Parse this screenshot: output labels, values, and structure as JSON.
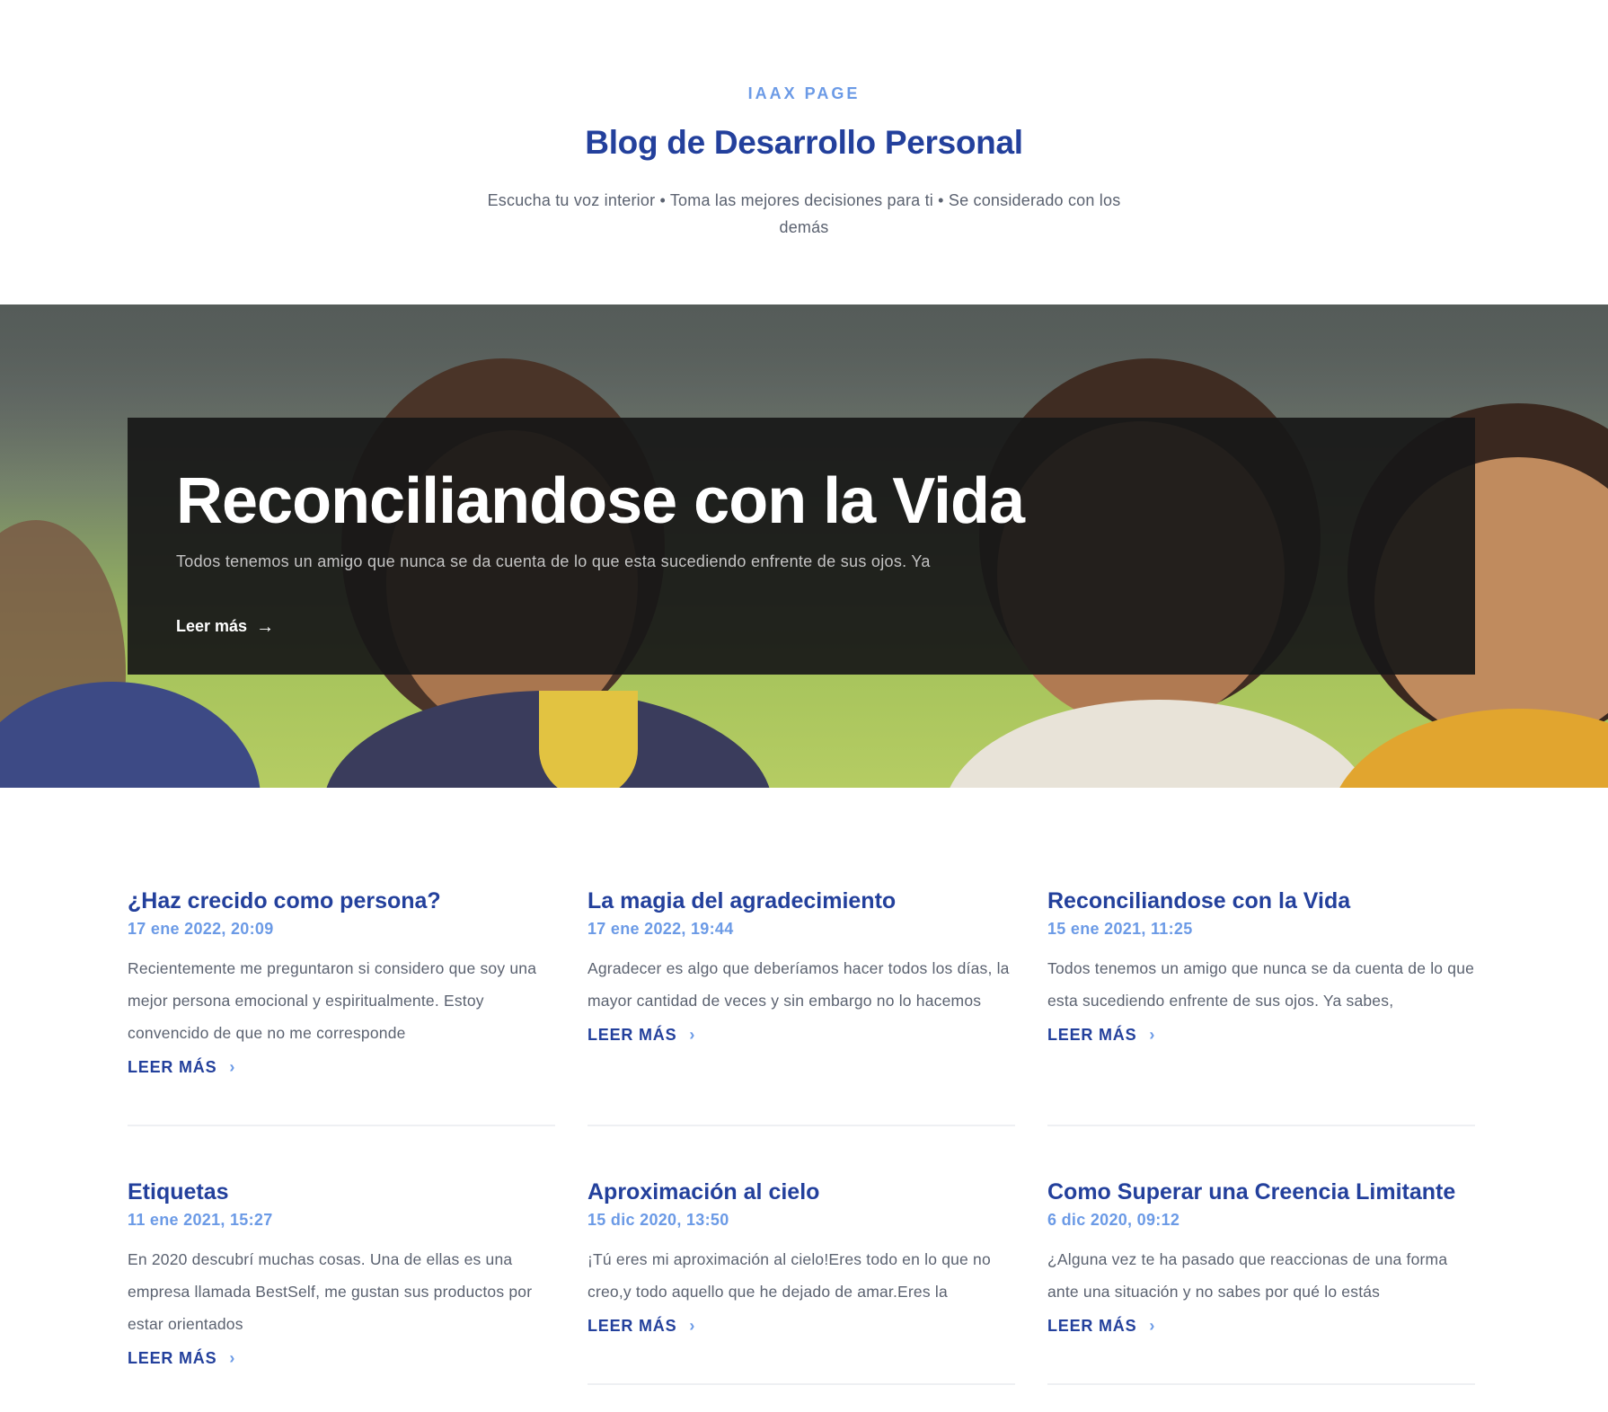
{
  "header": {
    "eyebrow": "IAAX PAGE",
    "title": "Blog de Desarrollo Personal",
    "tagline": "Escucha tu voz interior • Toma las mejores decisiones para ti • Se considerado con los demás"
  },
  "hero": {
    "title": "Reconciliandose con la Vida",
    "excerpt": "Todos tenemos un amigo que nunca se da cuenta de lo que esta sucediendo enfrente de sus ojos. Ya",
    "link_label": "Leer más",
    "link_icon": "arrow-right-icon",
    "image_alt": "children-smiling-photo"
  },
  "posts": [
    {
      "title": "¿Haz crecido como persona?",
      "date": "17 ene 2022, 20:09",
      "excerpt": "Recientemente me preguntaron si considero que soy una mejor persona emocional y espiritualmente. Estoy convencido de que no me corresponde",
      "link_label": "LEER MÁS"
    },
    {
      "title": "La magia del agradecimiento",
      "date": "17 ene 2022, 19:44",
      "excerpt": "Agradecer es algo que deberíamos hacer todos los días, la mayor cantidad de veces y sin embargo no lo hacemos",
      "link_label": "LEER MÁS"
    },
    {
      "title": "Reconciliandose con la Vida",
      "date": "15 ene 2021, 11:25",
      "excerpt": "Todos tenemos un amigo que nunca se da cuenta de lo que esta sucediendo enfrente de sus ojos. Ya sabes,",
      "link_label": "LEER MÁS"
    },
    {
      "title": "Etiquetas",
      "date": "11 ene 2021, 15:27",
      "excerpt": "En 2020 descubrí muchas cosas. Una de ellas es una empresa llamada BestSelf, me gustan sus productos por estar orientados",
      "link_label": "LEER MÁS"
    },
    {
      "title": "Aproximación al cielo",
      "date": "15 dic 2020, 13:50",
      "excerpt": "¡Tú eres mi aproximación al cielo!Eres todo en lo que no creo,y todo aquello que he dejado de amar.Eres la",
      "link_label": "LEER MÁS"
    },
    {
      "title": "Como Superar una Creencia Limitante",
      "date": "6 dic 2020, 09:12",
      "excerpt": "¿Alguna vez te ha pasado que reaccionas de una forma ante una situación y no sabes por qué lo estás",
      "link_label": "LEER MÁS"
    }
  ],
  "colors": {
    "brand": "#23409c",
    "accent": "#6b9ae6",
    "text": "#5b6270"
  }
}
